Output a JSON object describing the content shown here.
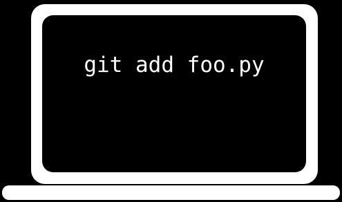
{
  "illustration": {
    "subject": "laptop",
    "screen": {
      "command": "git add foo.py",
      "background_color": "#000000",
      "text_color": "#ffffff"
    },
    "frame_color": "#ffffff",
    "page_background": "#000000"
  }
}
